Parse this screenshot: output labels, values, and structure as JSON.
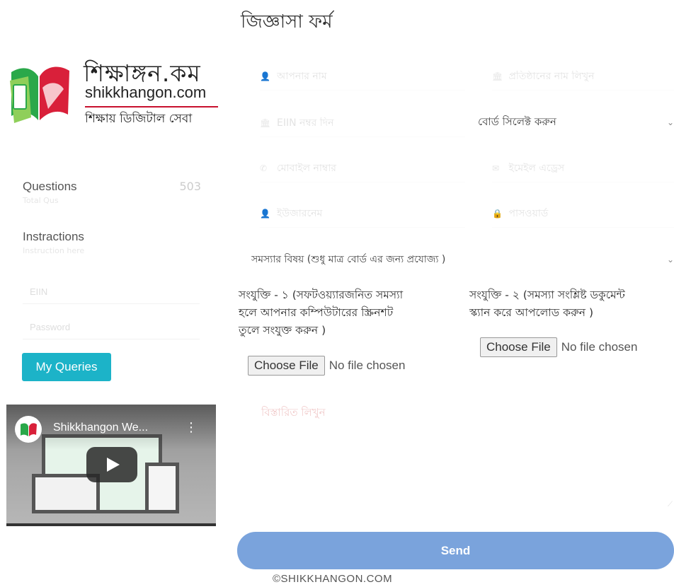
{
  "brand": {
    "name_bn": "শিক্ষাঙ্গন.কম",
    "domain": "shikkhangon.com",
    "tagline": "শিক্ষায় ডিজিটাল সেবা",
    "accent": "#c8102e"
  },
  "sidebar": {
    "stats": [
      {
        "label": "Questions",
        "value": "503",
        "sub": "Total Qus"
      },
      {
        "label": "Instractions",
        "value": "",
        "sub": "Instruction here"
      }
    ],
    "login": {
      "eiin_placeholder": "EIIN",
      "password_placeholder": "Password"
    },
    "my_queries_label": "My Queries",
    "my_queries_color": "#1cb3c8",
    "video": {
      "title": "Shikkhangon We...",
      "menu_icon": "more-vert-icon",
      "play_icon": "play-icon"
    }
  },
  "form": {
    "title": "জিজ্ঞাসা ফর্ম",
    "fields": {
      "name": {
        "icon": "user-icon",
        "placeholder": "আপনার নাম"
      },
      "institution": {
        "icon": "institution-icon",
        "placeholder": "প্রতিষ্ঠানের নাম লিখুন"
      },
      "eiin": {
        "icon": "institution-icon",
        "placeholder": "EIIN নম্বর দিন"
      },
      "board": {
        "selected": "বোর্ড সিলেক্ট করুন"
      },
      "mobile": {
        "icon": "phone-icon",
        "placeholder": "মোবাইল নাম্বার"
      },
      "email": {
        "icon": "envelope-icon",
        "placeholder": "ইমেইল এড্রেস"
      },
      "username": {
        "icon": "user-icon",
        "placeholder": "ইউজারনেম"
      },
      "password": {
        "icon": "lock-icon",
        "placeholder": "পাসওয়ার্ড"
      },
      "subject": {
        "selected": "সমস্যার বিষয় (শুধু মাত্র বোর্ড এর জন্য প্রযোজ্য )"
      }
    },
    "attachments": [
      {
        "label_lines": [
          "সংযুক্তি - ১ (সফটওয়্যারজনিত সমস্যা",
          "হলে আপনার কম্পিউটারের স্ক্রিনশট",
          "তুলে সংযুক্ত করুন )"
        ],
        "button": "Choose File",
        "status": "No file chosen"
      },
      {
        "label_lines": [
          "সংযুক্তি - ২ (সমস্যা সংশ্লিষ্ট ডকুমেন্ট",
          "স্ক্যান করে আপলোড করুন )"
        ],
        "button": "Choose File",
        "status": "No file chosen"
      }
    ],
    "details_placeholder": "বিস্তারিত লিখুন",
    "send_label": "Send",
    "send_color": "#7aa3dc"
  },
  "footer": {
    "copyright": "©SHIKKHANGON.COM"
  }
}
